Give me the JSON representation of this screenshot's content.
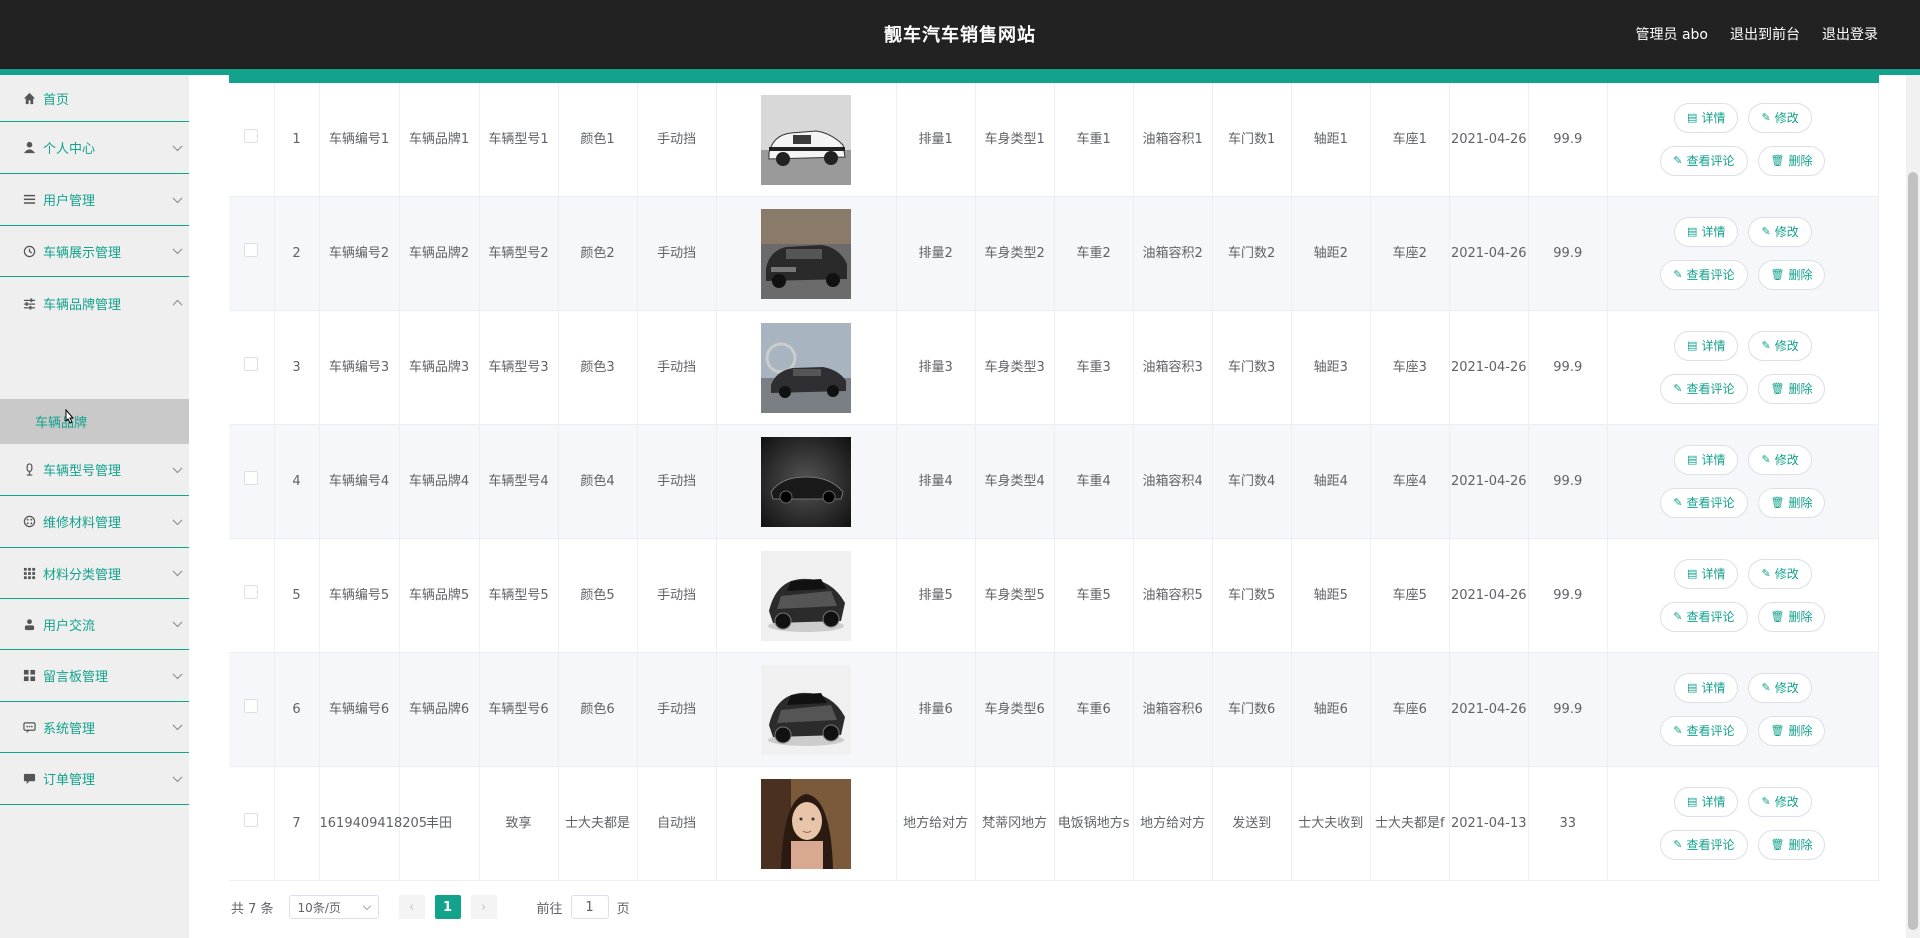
{
  "header": {
    "title": "靓车汽车销售网站",
    "admin_label": "管理员 abo",
    "to_front": "退出到前台",
    "logout": "退出登录"
  },
  "sidebar": {
    "items": [
      {
        "label": "首页",
        "icon": "home-icon"
      },
      {
        "label": "个人中心",
        "icon": "user-icon"
      },
      {
        "label": "用户管理",
        "icon": "list-icon"
      },
      {
        "label": "车辆展示管理",
        "icon": "clock-icon"
      },
      {
        "label": "车辆品牌管理",
        "icon": "sliders-icon"
      },
      {
        "label": "车辆型号管理",
        "icon": "mic-icon"
      },
      {
        "label": "维修材料管理",
        "icon": "palette-icon"
      },
      {
        "label": "材料分类管理",
        "icon": "grid-icon"
      },
      {
        "label": "用户交流",
        "icon": "person-icon"
      },
      {
        "label": "留言板管理",
        "icon": "apps-icon"
      },
      {
        "label": "系统管理",
        "icon": "chat-icon"
      },
      {
        "label": "订单管理",
        "icon": "message-icon"
      }
    ],
    "submenu_label": "车辆品牌"
  },
  "table": {
    "rows": [
      {
        "index": "1",
        "code": "车辆编号1",
        "brand": "车辆品牌1",
        "model": "车辆型号1",
        "color": "颜色1",
        "gearbox": "手动挡",
        "image": "white-coupe",
        "displacement": "排量1",
        "body_type": "车身类型1",
        "weight": "车重1",
        "tank": "油箱容积1",
        "doors": "车门数1",
        "wheelbase": "轴距1",
        "seats": "车座1",
        "date": "2021-04-26",
        "price": "99.9"
      },
      {
        "index": "2",
        "code": "车辆编号2",
        "brand": "车辆品牌2",
        "model": "车辆型号2",
        "color": "颜色2",
        "gearbox": "手动挡",
        "image": "dark-sedan",
        "displacement": "排量2",
        "body_type": "车身类型2",
        "weight": "车重2",
        "tank": "油箱容积2",
        "doors": "车门数2",
        "wheelbase": "轴距2",
        "seats": "车座2",
        "date": "2021-04-26",
        "price": "99.9"
      },
      {
        "index": "3",
        "code": "车辆编号3",
        "brand": "车辆品牌3",
        "model": "车辆型号3",
        "color": "颜色3",
        "gearbox": "手动挡",
        "image": "sedan-road",
        "displacement": "排量3",
        "body_type": "车身类型3",
        "weight": "车重3",
        "tank": "油箱容积3",
        "doors": "车门数3",
        "wheelbase": "轴距3",
        "seats": "车座3",
        "date": "2021-04-26",
        "price": "99.9"
      },
      {
        "index": "4",
        "code": "车辆编号4",
        "brand": "车辆品牌4",
        "model": "车辆型号4",
        "color": "颜色4",
        "gearbox": "手动挡",
        "image": "roadster-dark",
        "displacement": "排量4",
        "body_type": "车身类型4",
        "weight": "车重4",
        "tank": "油箱容积4",
        "doors": "车门数4",
        "wheelbase": "轴距4",
        "seats": "车座4",
        "date": "2021-04-26",
        "price": "99.9"
      },
      {
        "index": "5",
        "code": "车辆编号5",
        "brand": "车辆品牌5",
        "model": "车辆型号5",
        "color": "颜色5",
        "gearbox": "手动挡",
        "image": "supercar",
        "displacement": "排量5",
        "body_type": "车身类型5",
        "weight": "车重5",
        "tank": "油箱容积5",
        "doors": "车门数5",
        "wheelbase": "轴距5",
        "seats": "车座5",
        "date": "2021-04-26",
        "price": "99.9"
      },
      {
        "index": "6",
        "code": "车辆编号6",
        "brand": "车辆品牌6",
        "model": "车辆型号6",
        "color": "颜色6",
        "gearbox": "手动挡",
        "image": "supercar",
        "displacement": "排量6",
        "body_type": "车身类型6",
        "weight": "车重6",
        "tank": "油箱容积6",
        "doors": "车门数6",
        "wheelbase": "轴距6",
        "seats": "车座6",
        "date": "2021-04-26",
        "price": "99.9"
      },
      {
        "index": "7",
        "code": "1619409418205",
        "brand": "丰田",
        "model": "致享",
        "color": "士大夫都是",
        "gearbox": "自动挡",
        "image": "portrait",
        "displacement": "地方给对方",
        "body_type": "梵蒂冈地方",
        "weight": "电饭锅地方s",
        "tank": "地方给对方",
        "doors": "发送到",
        "wheelbase": "士大夫收到",
        "seats": "士大夫都是f",
        "date": "2021-04-13",
        "price": "33"
      }
    ],
    "ops": {
      "detail": "详情",
      "edit": "修改",
      "comments": "查看评论",
      "delete": "删除"
    }
  },
  "pagination": {
    "total": "共 7 条",
    "page_size": "10条/页",
    "current": "1",
    "goto_prefix": "前往",
    "goto_value": "1",
    "goto_suffix": "页"
  },
  "colors": {
    "accent": "#13a38c",
    "header_bg": "#222222",
    "sidebar_bg": "#efefef",
    "submenu_bg": "#c9c9c9"
  }
}
